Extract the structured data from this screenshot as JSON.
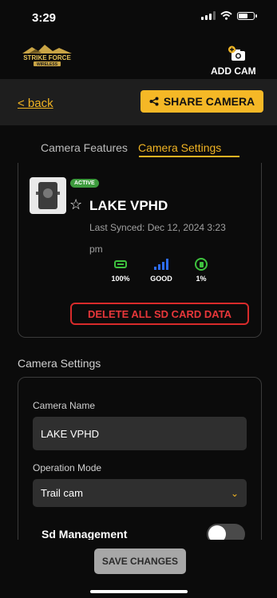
{
  "status_bar": {
    "time": "3:29"
  },
  "header": {
    "logo_text": "STRIKE FORCE WIRELESS",
    "add_cam_label": "ADD CAM",
    "icons": {
      "add_cam": "camera-plus-icon"
    }
  },
  "nav": {
    "back_label": "< back",
    "share_label": "SHARE CAMERA"
  },
  "tabs": [
    {
      "label": "Camera Features",
      "active": false
    },
    {
      "label": "Camera Settings",
      "active": true
    }
  ],
  "camera": {
    "status_badge": "ACTIVE",
    "name": "LAKE VPHD",
    "last_synced": "Last Synced: Dec 12, 2024 3:23 pm",
    "stats": {
      "battery": "100%",
      "signal": "GOOD",
      "sd_card": "1%"
    },
    "delete_label": "DELETE ALL SD CARD DATA"
  },
  "settings": {
    "section_title": "Camera Settings",
    "camera_name_label": "Camera Name",
    "camera_name_value": "LAKE VPHD",
    "operation_mode_label": "Operation Mode",
    "operation_mode_value": "Trail cam",
    "sd_management_label": "Sd Management",
    "sd_management_on": false
  },
  "footer": {
    "save_label": "SAVE CHANGES"
  },
  "colors": {
    "accent": "#f5b826",
    "danger": "#d82b2b",
    "good": "#3ec23e",
    "signal": "#2e6df5"
  }
}
